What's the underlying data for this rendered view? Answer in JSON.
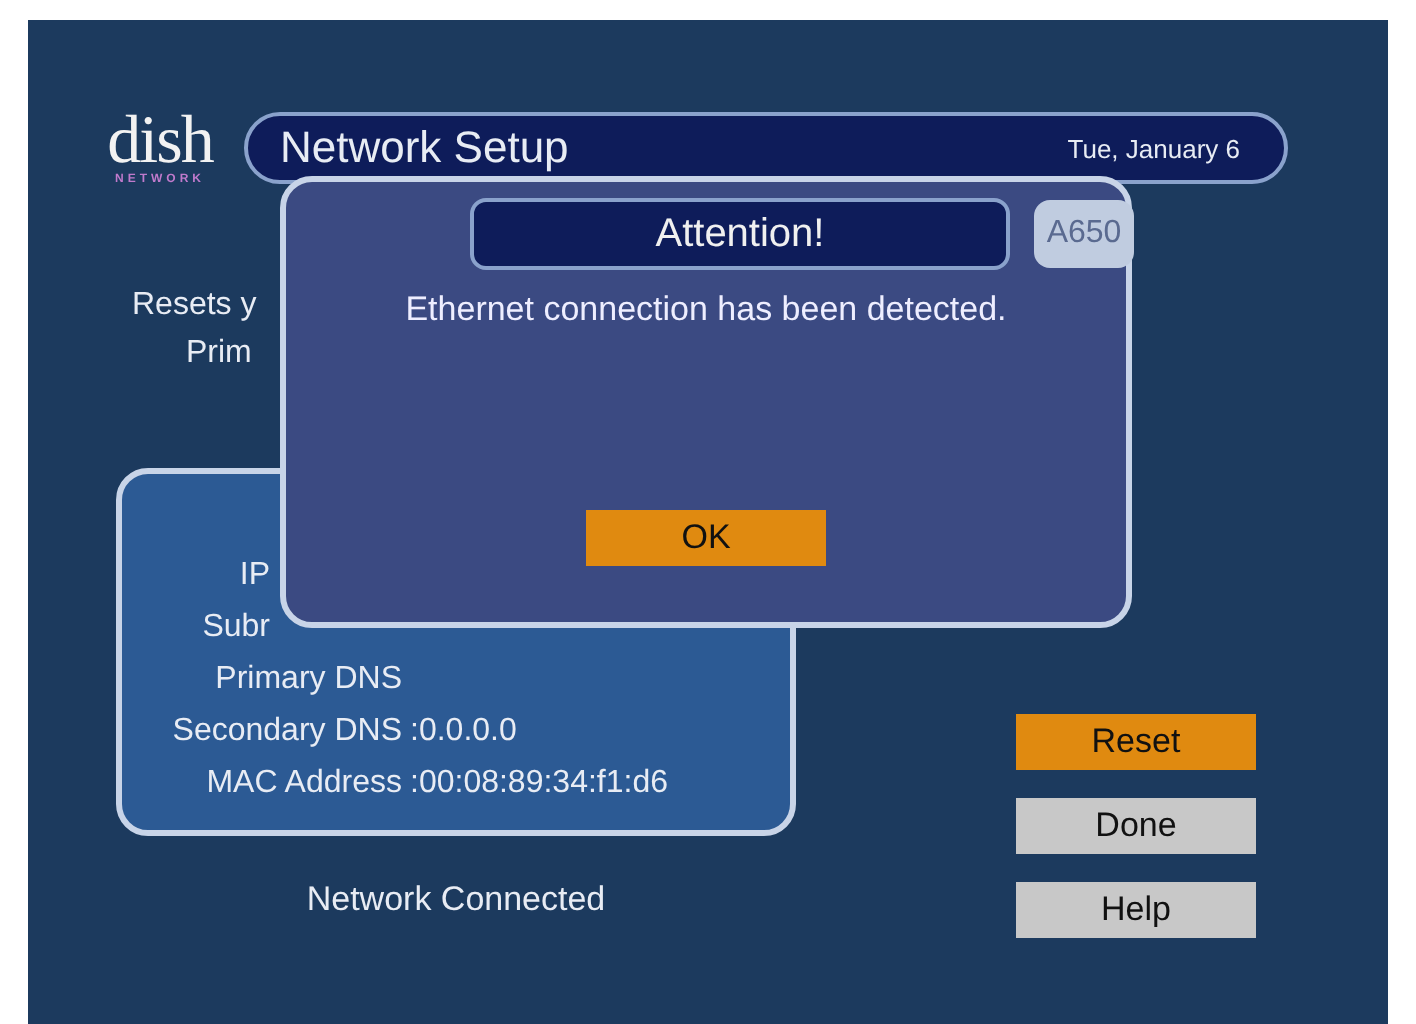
{
  "logo": {
    "word": "dish",
    "sub": "NETWORK"
  },
  "header": {
    "title": "Network Setup",
    "date": "Tue, January 6"
  },
  "description": [
    "Resets y",
    "Prim"
  ],
  "info_rows": [
    {
      "kind": "cut",
      "label": "IP"
    },
    {
      "kind": "cut",
      "label": "Subr"
    },
    {
      "kind": "full",
      "label": "Primary DNS"
    },
    {
      "kind": "full",
      "label": "Secondary DNS",
      "value": ":0.0.0.0"
    },
    {
      "kind": "full",
      "label": "MAC Address",
      "value": ":00:08:89:34:f1:d6"
    }
  ],
  "status": "Network Connected",
  "buttons": [
    {
      "label": "Reset",
      "selected": true
    },
    {
      "label": "Done",
      "selected": false
    },
    {
      "label": "Help",
      "selected": false
    }
  ],
  "dialog": {
    "title": "Attention!",
    "code": "A650",
    "message": "Ethernet connection has been detected.",
    "button": {
      "label": "OK",
      "selected": true
    }
  }
}
